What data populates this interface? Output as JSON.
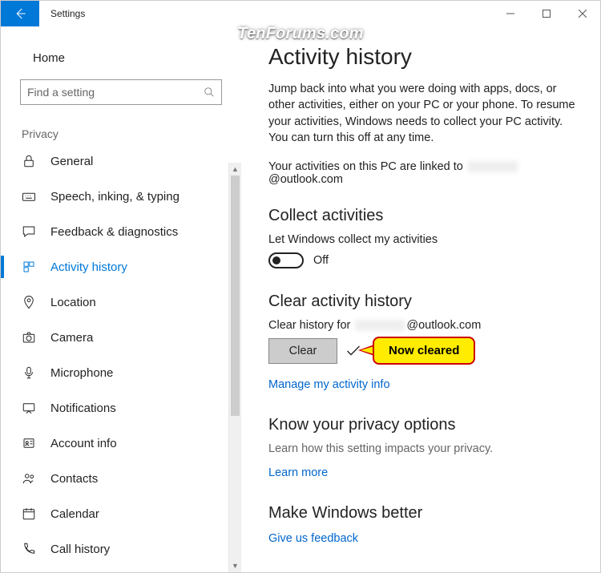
{
  "window": {
    "title": "Settings"
  },
  "watermark": "TenForums.com",
  "sidebar": {
    "home": "Home",
    "search_placeholder": "Find a setting",
    "group": "Privacy",
    "items": [
      {
        "label": "General"
      },
      {
        "label": "Speech, inking, & typing"
      },
      {
        "label": "Feedback & diagnostics"
      },
      {
        "label": "Activity history"
      },
      {
        "label": "Location"
      },
      {
        "label": "Camera"
      },
      {
        "label": "Microphone"
      },
      {
        "label": "Notifications"
      },
      {
        "label": "Account info"
      },
      {
        "label": "Contacts"
      },
      {
        "label": "Calendar"
      },
      {
        "label": "Call history"
      }
    ]
  },
  "main": {
    "title": "Activity history",
    "description": "Jump back into what you were doing with apps, docs, or other activities, either on your PC or your phone. To resume your activities, Windows needs to collect your PC activity. You can turn this off at any time.",
    "linked_prefix": "Your activities on this PC are linked to ",
    "linked_suffix": "@outlook.com",
    "collect_heading": "Collect activities",
    "collect_label": "Let Windows collect my activities",
    "toggle_state": "Off",
    "clear_heading": "Clear activity history",
    "clear_label_prefix": "Clear history for ",
    "clear_label_suffix": "@outlook.com",
    "clear_button": "Clear",
    "callout": "Now cleared",
    "manage_link": "Manage my activity info",
    "know_heading": "Know your privacy options",
    "know_sub": "Learn how this setting impacts your privacy.",
    "learn_more": "Learn more",
    "better_heading": "Make Windows better",
    "feedback_link": "Give us feedback"
  }
}
